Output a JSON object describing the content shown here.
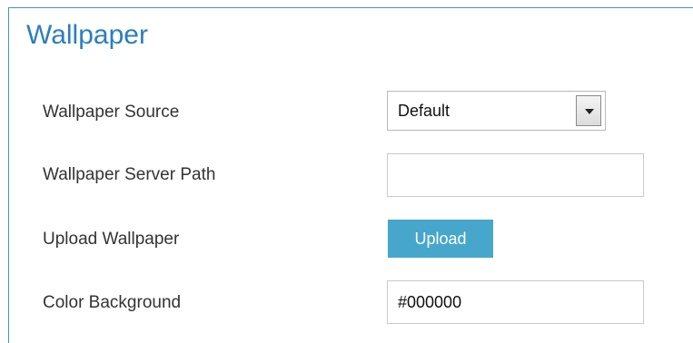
{
  "section": {
    "title": "Wallpaper"
  },
  "fields": {
    "wallpaper_source": {
      "label": "Wallpaper Source",
      "selected": "Default"
    },
    "wallpaper_server_path": {
      "label": "Wallpaper Server Path",
      "value": ""
    },
    "upload_wallpaper": {
      "label": "Upload Wallpaper",
      "button_label": "Upload"
    },
    "color_background": {
      "label": "Color Background",
      "value": "#000000"
    }
  },
  "colors": {
    "accent": "#2b7ec1",
    "button": "#46a6cc",
    "panel_border": "#4a90c8"
  },
  "icons": {
    "dropdown": "chevron-down-icon"
  }
}
